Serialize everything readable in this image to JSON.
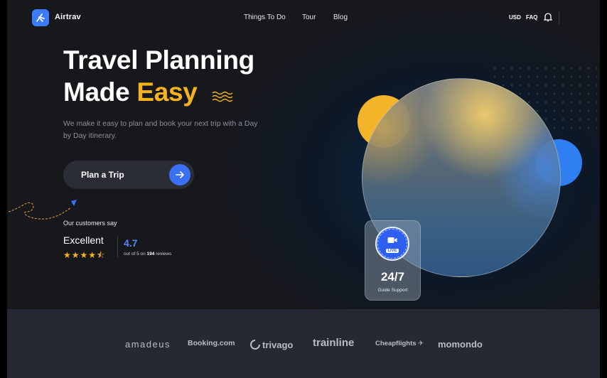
{
  "brand": {
    "name": "Airtrav",
    "icon": "airtrav-logo-icon",
    "accent": "#3b7bff"
  },
  "nav": {
    "links": [
      "Things To Do",
      "Tour",
      "Blog"
    ],
    "currency": "USD",
    "faq": "FAQ",
    "bell_icon": "bell-icon"
  },
  "hero": {
    "title_line1": "Travel Planning",
    "title_line2_part1": "Made ",
    "title_line2_highlight": "Easy",
    "highlight_color": "#f6b21b",
    "subtitle": "We make it easy to plan and book your next trip with a Day by Day itinerary.",
    "cta_label": "Plan a Trip",
    "cta_icon": "arrow-right-icon"
  },
  "reviews": {
    "heading": "Our customers say",
    "rating_word": "Excellent",
    "stars": "★★★★⯪",
    "stars_value": 4.5,
    "score": "4.7",
    "summary_prefix": "out of 5 on ",
    "count": "194",
    "summary_suffix": " reviews"
  },
  "support": {
    "live_badge": "LIVE",
    "video_icon": "video-camera-icon",
    "hours": "24/7",
    "caption": "Guide Support"
  },
  "partners": [
    "amadeus",
    "Booking.com",
    "trivago",
    "trainline",
    "Cheapflights",
    "momondo"
  ]
}
